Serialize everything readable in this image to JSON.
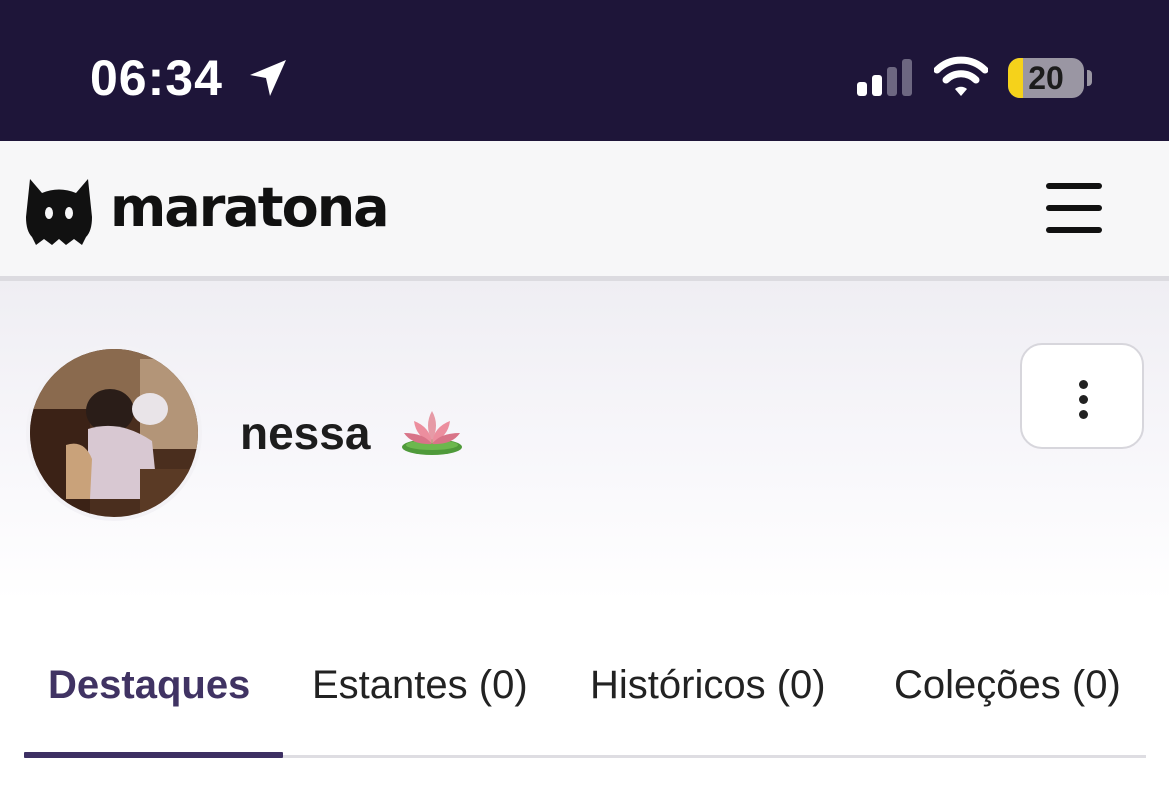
{
  "status_bar": {
    "time": "06:34",
    "battery": "20",
    "battery_level": 0.2,
    "icons": [
      "location-arrow-icon",
      "cellular-signal-icon",
      "wifi-icon",
      "battery-icon"
    ]
  },
  "header": {
    "logo_text": "maratona",
    "icons": [
      "cat-logo-icon",
      "hamburger-menu-icon"
    ]
  },
  "profile": {
    "username": "nessa",
    "emoji": "lotus-icon",
    "more_icon": "vertical-dots-icon"
  },
  "tabs": [
    {
      "label": "Destaques",
      "active": true
    },
    {
      "label": "Estantes (0)",
      "active": false
    },
    {
      "label": "Históricos (0)",
      "active": false
    },
    {
      "label": "Coleções (0)",
      "active": false
    }
  ],
  "colors": {
    "status_bar_bg": "#1e1539",
    "accent": "#3d3063",
    "battery_low": "#f5d21b"
  }
}
